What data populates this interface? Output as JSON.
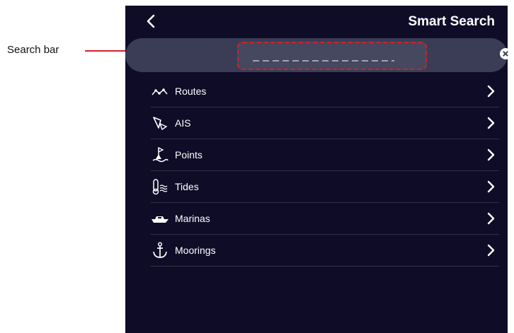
{
  "annotation": {
    "callout_label": "Search bar"
  },
  "header": {
    "title": "Smart Search",
    "back_icon": "back-arrow-icon"
  },
  "search": {
    "value": "",
    "placeholder": "",
    "clear_icon": "clear-circle-icon"
  },
  "menu": {
    "items": [
      {
        "label": "Routes",
        "icon": "route-icon"
      },
      {
        "label": "AIS",
        "icon": "ais-target-icon"
      },
      {
        "label": "Points",
        "icon": "buoy-flag-icon"
      },
      {
        "label": "Tides",
        "icon": "tide-thermometer-icon"
      },
      {
        "label": "Marinas",
        "icon": "boat-icon"
      },
      {
        "label": "Moorings",
        "icon": "anchor-icon"
      }
    ]
  },
  "colors": {
    "screen_background": "#0f0c28",
    "search_pill": "#3a3d55",
    "callout_red": "#d4202a",
    "divider": "#2f3148"
  }
}
